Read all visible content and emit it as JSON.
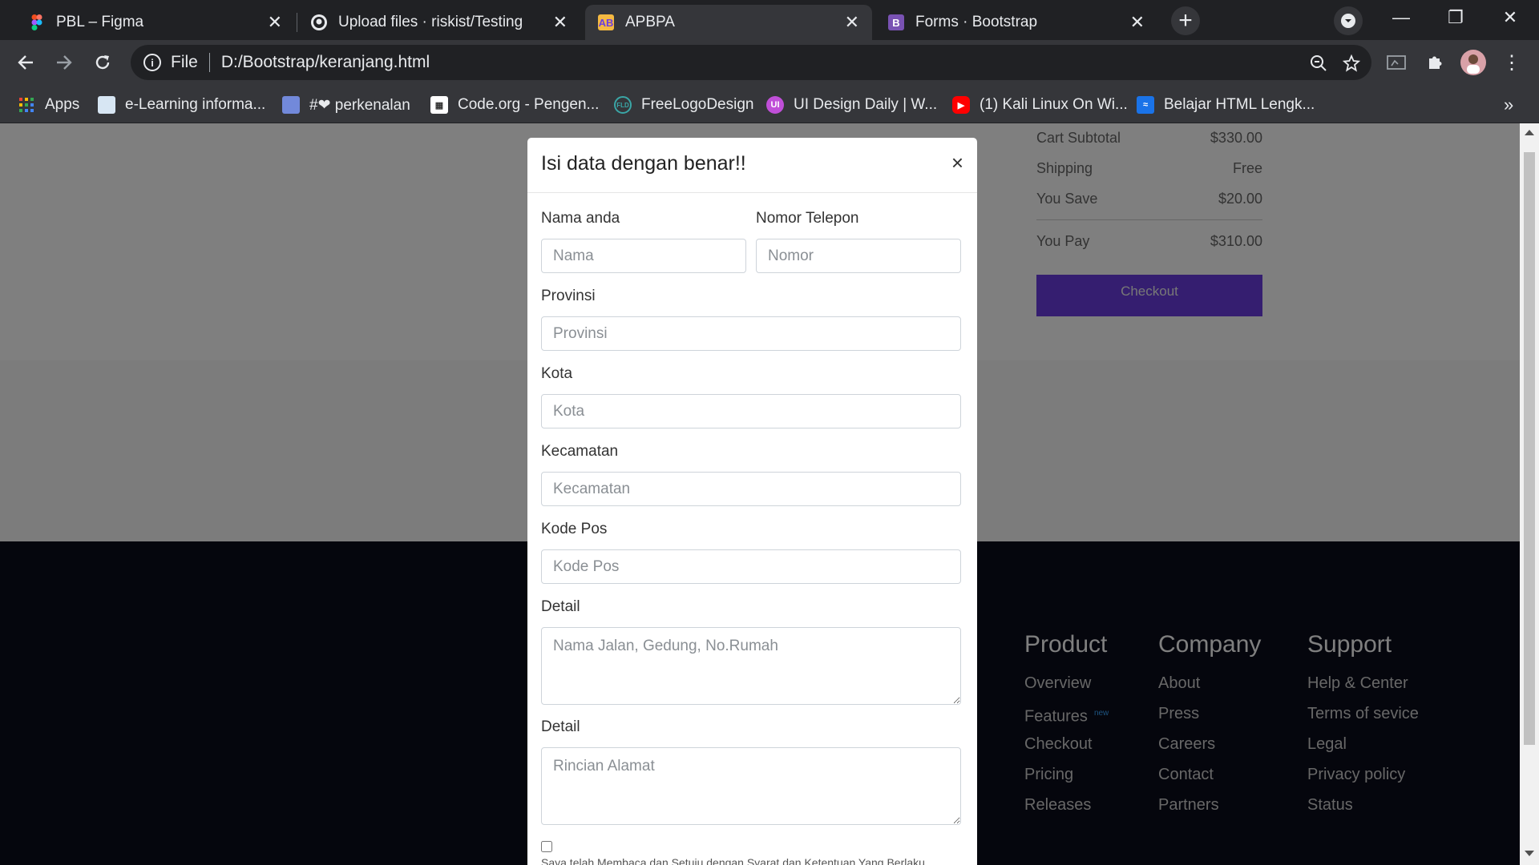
{
  "tabs": [
    {
      "title": "PBL – Figma",
      "icon": "figma-icon"
    },
    {
      "title": "Upload files · riskist/Testing",
      "icon": "github-icon"
    },
    {
      "title": "APBPA",
      "icon": "apbpa-icon"
    },
    {
      "title": "Forms · Bootstrap",
      "icon": "bootstrap-icon"
    }
  ],
  "address": {
    "scheme": "File",
    "url": "D:/Bootstrap/keranjang.html"
  },
  "bookmarks": [
    {
      "label": "Apps"
    },
    {
      "label": "e-Learning informa..."
    },
    {
      "label": "#❤ perkenalan"
    },
    {
      "label": "Code.org - Pengen..."
    },
    {
      "label": "FreeLogoDesign"
    },
    {
      "label": "UI Design Daily | W..."
    },
    {
      "label": "(1) Kali Linux On Wi..."
    },
    {
      "label": "Belajar HTML Lengk..."
    }
  ],
  "cart": {
    "rows": [
      {
        "label": "Cart Subtotal",
        "value": "$330.00"
      },
      {
        "label": "Shipping",
        "value": "Free"
      },
      {
        "label": "You Save",
        "value": "$20.00"
      },
      {
        "label": "You Pay",
        "value": "$310.00"
      }
    ],
    "checkout_label": "Checkout",
    "accent": "#6a3de0"
  },
  "footer": {
    "columns": [
      {
        "title": "Product",
        "links": [
          "Overview",
          "Features",
          "Checkout",
          "Pricing",
          "Releases"
        ],
        "badge": "new"
      },
      {
        "title": "Company",
        "links": [
          "About",
          "Press",
          "Careers",
          "Contact",
          "Partners"
        ]
      },
      {
        "title": "Support",
        "links": [
          "Help & Center",
          "Terms of sevice",
          "Legal",
          "Privacy policy",
          "Status"
        ]
      }
    ]
  },
  "modal": {
    "title": "Isi data dengan benar!!",
    "close": "×",
    "fields": {
      "nama": {
        "label": "Nama anda",
        "placeholder": "Nama"
      },
      "telepon": {
        "label": "Nomor Telepon",
        "placeholder": "Nomor"
      },
      "provinsi": {
        "label": "Provinsi",
        "placeholder": "Provinsi"
      },
      "kota": {
        "label": "Kota",
        "placeholder": "Kota"
      },
      "kecamatan": {
        "label": "Kecamatan",
        "placeholder": "Kecamatan"
      },
      "kodepos": {
        "label": "Kode Pos",
        "placeholder": "Kode Pos"
      },
      "detail1": {
        "label": "Detail",
        "placeholder": "Nama Jalan, Gedung, No.Rumah"
      },
      "detail2": {
        "label": "Detail",
        "placeholder": "Rincian Alamat"
      }
    },
    "checkbox_text": "Saya telah Membaca dan Setuju dengan Syarat dan Ketentuan Yang Berlaku"
  }
}
